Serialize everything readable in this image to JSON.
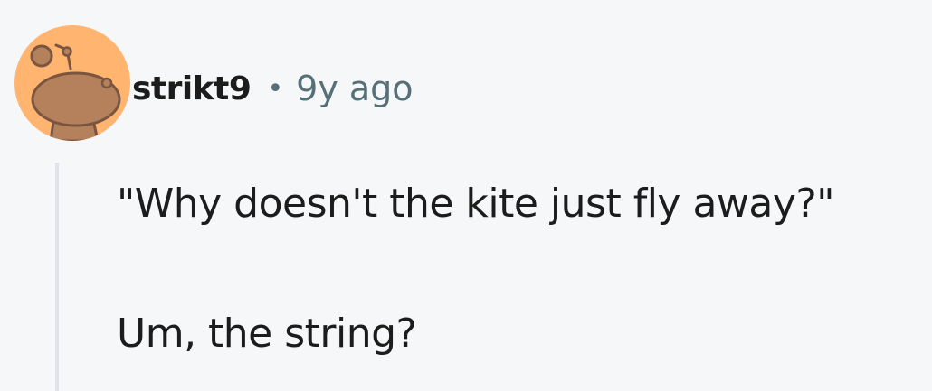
{
  "comment": {
    "author": "strikt9",
    "separator": "•",
    "timestamp": "9y ago",
    "paragraphs": [
      "\"Why doesn't the kite just fly away?\"",
      "Um, the string?"
    ],
    "avatar": {
      "icon": "snoo-avatar-icon",
      "background_color": "#ffb470"
    }
  }
}
